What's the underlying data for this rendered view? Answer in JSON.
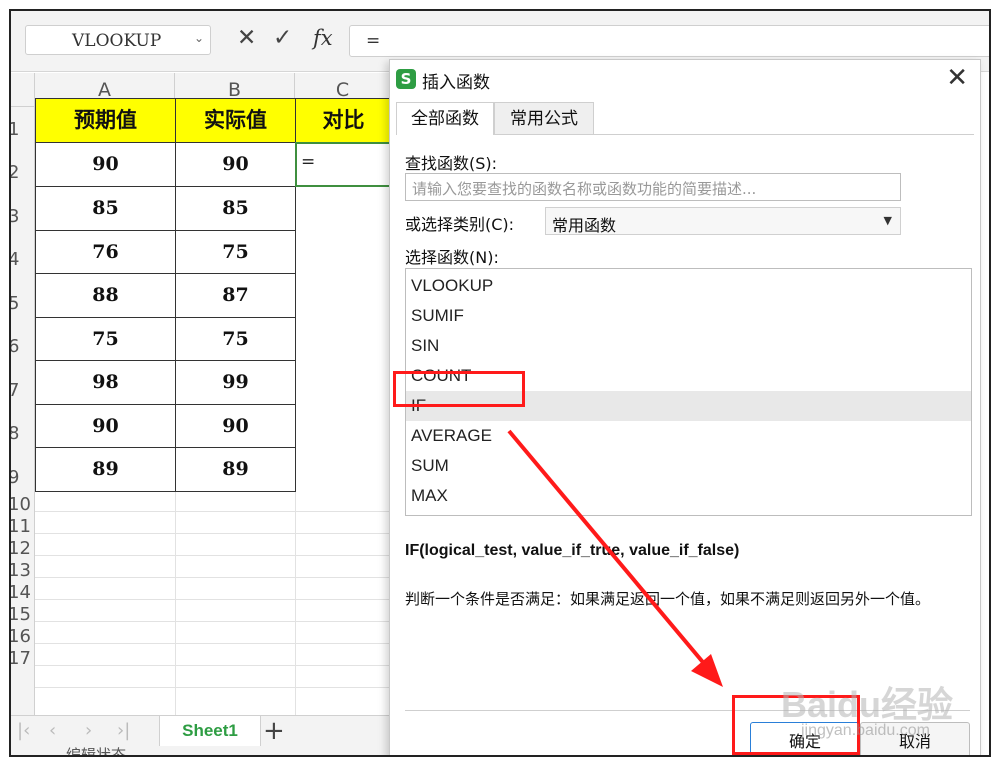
{
  "formula_bar": {
    "name_box": "VLOOKUP",
    "cancel_glyph": "✕",
    "confirm_glyph": "✓",
    "fx_label": "fx",
    "formula": "="
  },
  "sheet": {
    "columns": [
      "A",
      "B",
      "C"
    ],
    "rows": [
      "1",
      "2",
      "3",
      "4",
      "5",
      "6",
      "7",
      "8",
      "9",
      "10",
      "11",
      "12",
      "13",
      "14",
      "15",
      "16",
      "17"
    ],
    "headers": [
      "预期值",
      "实际值",
      "对比"
    ],
    "data": [
      [
        "90",
        "90"
      ],
      [
        "85",
        "85"
      ],
      [
        "76",
        "75"
      ],
      [
        "88",
        "87"
      ],
      [
        "75",
        "75"
      ],
      [
        "98",
        "99"
      ],
      [
        "90",
        "90"
      ],
      [
        "89",
        "89"
      ]
    ],
    "active_cell_value": "=",
    "tab_name": "Sheet1",
    "status_text": "编辑状态"
  },
  "dialog": {
    "title": "插入函数",
    "tabs": [
      "全部函数",
      "常用公式"
    ],
    "search_label": "查找函数(S):",
    "search_placeholder": "请输入您要查找的函数名称或函数功能的简要描述...",
    "category_label": "或选择类别(C):",
    "category_value": "常用函数",
    "function_label": "选择函数(N):",
    "functions": [
      "VLOOKUP",
      "SUMIF",
      "SIN",
      "COUNT",
      "IF",
      "AVERAGE",
      "SUM",
      "MAX"
    ],
    "selected_function": "IF",
    "signature": "IF(logical_test, value_if_true, value_if_false)",
    "description": "判断一个条件是否满足：如果满足返回一个值，如果不满足则返回另外一个值。",
    "ok_label": "确定",
    "cancel_label": "取消"
  },
  "watermark": {
    "text": "Baidu经验",
    "url_text": "jingyan.baidu.com"
  },
  "colors": {
    "header_fill": "#ffff00",
    "sheet_tab": "#2e9d43",
    "annotation": "#ff1a1a"
  }
}
